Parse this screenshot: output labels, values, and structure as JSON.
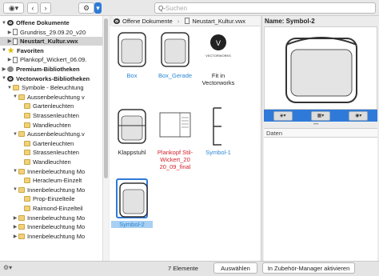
{
  "toolbar": {
    "search_placeholder": "Suchen",
    "search_prefix": "Q-"
  },
  "tree": [
    {
      "label": "Offene Dokumente",
      "bold": true,
      "icon": "circle",
      "indent": 0,
      "arrow": "▼"
    },
    {
      "label": "Grundriss_29.09.20_v20",
      "bold": false,
      "icon": "doc",
      "indent": 1,
      "arrow": "▶"
    },
    {
      "label": "Neustart_Kultur.vwx",
      "bold": true,
      "icon": "doc",
      "indent": 1,
      "arrow": "▶",
      "selected": true
    },
    {
      "label": "Favoriten",
      "bold": true,
      "icon": "star",
      "indent": 0,
      "arrow": "▼"
    },
    {
      "label": "Plankopf_Wickert_06.09.",
      "bold": false,
      "icon": "doc",
      "indent": 1,
      "arrow": "▶"
    },
    {
      "label": "Premium-Bibliotheken",
      "bold": true,
      "icon": "gray",
      "indent": 0,
      "arrow": "▶"
    },
    {
      "label": "Vectorworks-Bibliotheken",
      "bold": true,
      "icon": "circle",
      "indent": 0,
      "arrow": "▼"
    },
    {
      "label": "Symbole - Beleuchtung",
      "bold": false,
      "icon": "folder",
      "indent": 1,
      "arrow": "▼"
    },
    {
      "label": "Aussenbeleuchtung v",
      "bold": false,
      "icon": "folder",
      "indent": 2,
      "arrow": "▼"
    },
    {
      "label": "Gartenleuchten",
      "bold": false,
      "icon": "folder",
      "indent": 3,
      "arrow": ""
    },
    {
      "label": "Strassenleuchten",
      "bold": false,
      "icon": "folder",
      "indent": 3,
      "arrow": ""
    },
    {
      "label": "Wandleuchten",
      "bold": false,
      "icon": "folder",
      "indent": 3,
      "arrow": ""
    },
    {
      "label": "Aussenbeleuchtung.v",
      "bold": false,
      "icon": "folder",
      "indent": 2,
      "arrow": "▼"
    },
    {
      "label": "Gartenleuchten",
      "bold": false,
      "icon": "folder",
      "indent": 3,
      "arrow": ""
    },
    {
      "label": "Strassenleuchten",
      "bold": false,
      "icon": "folder",
      "indent": 3,
      "arrow": ""
    },
    {
      "label": "Wandleuchten",
      "bold": false,
      "icon": "folder",
      "indent": 3,
      "arrow": ""
    },
    {
      "label": "Innenbeleuchtung Mo",
      "bold": false,
      "icon": "folder",
      "indent": 2,
      "arrow": "▼"
    },
    {
      "label": "Heracleum-Einzelt",
      "bold": false,
      "icon": "folder",
      "indent": 3,
      "arrow": ""
    },
    {
      "label": "Innenbeleuchtung Mo",
      "bold": false,
      "icon": "folder",
      "indent": 2,
      "arrow": "▼"
    },
    {
      "label": "Prop-Einzelteile",
      "bold": false,
      "icon": "folder",
      "indent": 3,
      "arrow": ""
    },
    {
      "label": "Raimond-Einzelteil",
      "bold": false,
      "icon": "folder",
      "indent": 3,
      "arrow": ""
    },
    {
      "label": "Innenbeleuchtung Mo",
      "bold": false,
      "icon": "folder",
      "indent": 2,
      "arrow": "▶"
    },
    {
      "label": "Innenbeleuchtung Mo",
      "bold": false,
      "icon": "folder",
      "indent": 2,
      "arrow": "▶"
    },
    {
      "label": "Innenbeleuchtung Mo",
      "bold": false,
      "icon": "folder",
      "indent": 2,
      "arrow": "▶"
    }
  ],
  "breadcrumb": {
    "root": "Offene Dokumente",
    "current": "Neustart_Kultur.vwx"
  },
  "items": [
    {
      "label": "Box",
      "color": "blue",
      "kind": "chair"
    },
    {
      "label": "Box_Gerade",
      "color": "blue",
      "kind": "chair"
    },
    {
      "label": "Fit in Vectorworks",
      "color": "black",
      "kind": "logo",
      "logo_text": "VECTORWORKS"
    },
    {
      "label": "Klappstuhl",
      "color": "black",
      "kind": "chair2"
    },
    {
      "label": "Plankopf Stil-Wickert_20 20_09_final",
      "color": "red",
      "kind": "plan"
    },
    {
      "label": "Symbol-1",
      "color": "blue",
      "kind": "bracket"
    },
    {
      "label": "Symbol-2",
      "color": "blue",
      "kind": "chair",
      "selected": true
    }
  ],
  "right": {
    "name_label": "Name: Symbol-2",
    "data_header": "Daten"
  },
  "status": {
    "count": "7 Elemente",
    "select_button": "Auswählen",
    "activate_button": "In Zubehör-Manager aktivieren"
  },
  "colors": {
    "accent": "#2f7ad9",
    "link": "#2a86d6",
    "red": "#d3202a"
  }
}
